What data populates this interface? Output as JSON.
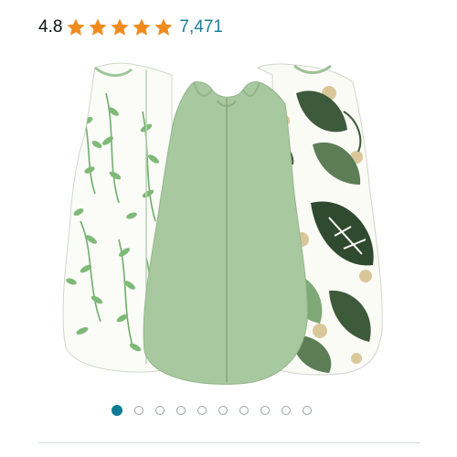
{
  "rating": {
    "value": "4.8",
    "stars": 5,
    "star_color": "#f08c1d",
    "review_count": "7,471",
    "review_count_color": "#1b7f97"
  },
  "product_image": {
    "icons": [
      "leaf-print-sleep-sack",
      "solid-sage-sleep-sack",
      "tropical-print-sleep-sack"
    ],
    "sage_color": "#a8c8a0",
    "leaf_color": "#6fae6a",
    "dark_leaf_color": "#3d5a3a",
    "gold_color": "#d9c79a"
  },
  "carousel": {
    "total": 10,
    "active_index": 0,
    "active_color": "#0e7a93"
  }
}
